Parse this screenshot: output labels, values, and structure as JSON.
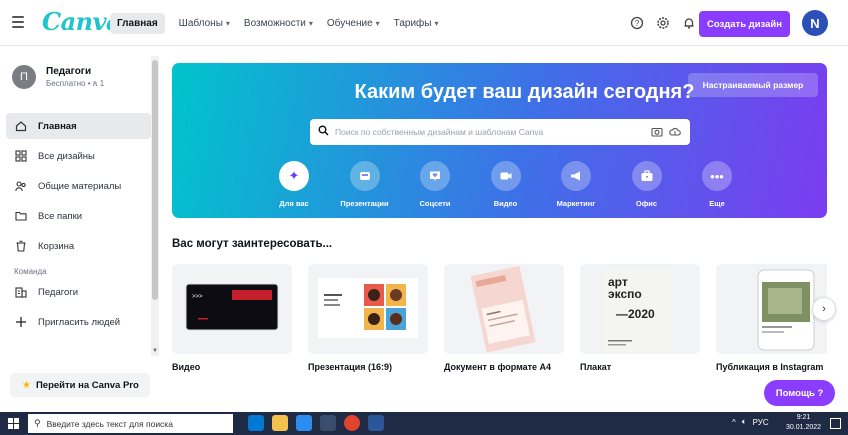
{
  "header": {
    "logo": "Canva",
    "nav": [
      {
        "label": "Главная",
        "active": true,
        "caret": false
      },
      {
        "label": "Шаблоны",
        "active": false,
        "caret": true
      },
      {
        "label": "Возможности",
        "active": false,
        "caret": true
      },
      {
        "label": "Обучение",
        "active": false,
        "caret": true
      },
      {
        "label": "Тарифы",
        "active": false,
        "caret": true
      }
    ],
    "icons": [
      "help-icon",
      "gear-icon",
      "bell-icon"
    ],
    "create_button": "Создать дизайн",
    "avatar_letter": "N",
    "accent_color": "#8b3dff"
  },
  "sidebar": {
    "team": {
      "initial": "П",
      "name": "Педагоги",
      "subtitle": "Бесплатно • ጰ 1"
    },
    "items": [
      {
        "label": "Главная",
        "icon": "home-icon",
        "active": true
      },
      {
        "label": "Все дизайны",
        "icon": "grid-icon",
        "active": false
      },
      {
        "label": "Общие материалы",
        "icon": "people-icon",
        "active": false
      },
      {
        "label": "Все папки",
        "icon": "folder-icon",
        "active": false
      },
      {
        "label": "Корзина",
        "icon": "trash-icon",
        "active": false
      }
    ],
    "section_label": "Команда",
    "team_items": [
      {
        "label": "Педагоги",
        "icon": "building-icon"
      },
      {
        "label": "Пригласить людей",
        "icon": "plus-icon"
      }
    ],
    "pro_button": "Перейти на Canva Pro"
  },
  "hero": {
    "title": "Каким будет ваш дизайн сегодня?",
    "custom_size_button": "Настраиваемый размер",
    "search_placeholder": "Поиск по собственным дизайнам и шаблонам Canva",
    "categories": [
      {
        "label": "Для вас",
        "icon": "sparkle-icon",
        "active": true
      },
      {
        "label": "Презентации",
        "icon": "presentation-icon",
        "active": false
      },
      {
        "label": "Соцсети",
        "icon": "heart-chat-icon",
        "active": false
      },
      {
        "label": "Видео",
        "icon": "video-icon",
        "active": false
      },
      {
        "label": "Маркетинг",
        "icon": "megaphone-icon",
        "active": false
      },
      {
        "label": "Офис",
        "icon": "briefcase-icon",
        "active": false
      },
      {
        "label": "Еще",
        "icon": "more-icon",
        "active": false
      }
    ]
  },
  "suggestions": {
    "title": "Вас могут заинтересовать...",
    "cards": [
      {
        "label": "Видео"
      },
      {
        "label": "Презентация (16:9)"
      },
      {
        "label": "Документ в формате А4"
      },
      {
        "label": "Плакат",
        "thumb_text": [
          "арт",
          "экспо",
          "—2020"
        ]
      },
      {
        "label": "Публикация в Instagram"
      }
    ]
  },
  "help_button": "Помощь ?",
  "taskbar": {
    "search_placeholder": "Введите здесь текст для поиска",
    "tray_lang": "РУС",
    "time": "9:21",
    "date": "30.01.2022"
  }
}
